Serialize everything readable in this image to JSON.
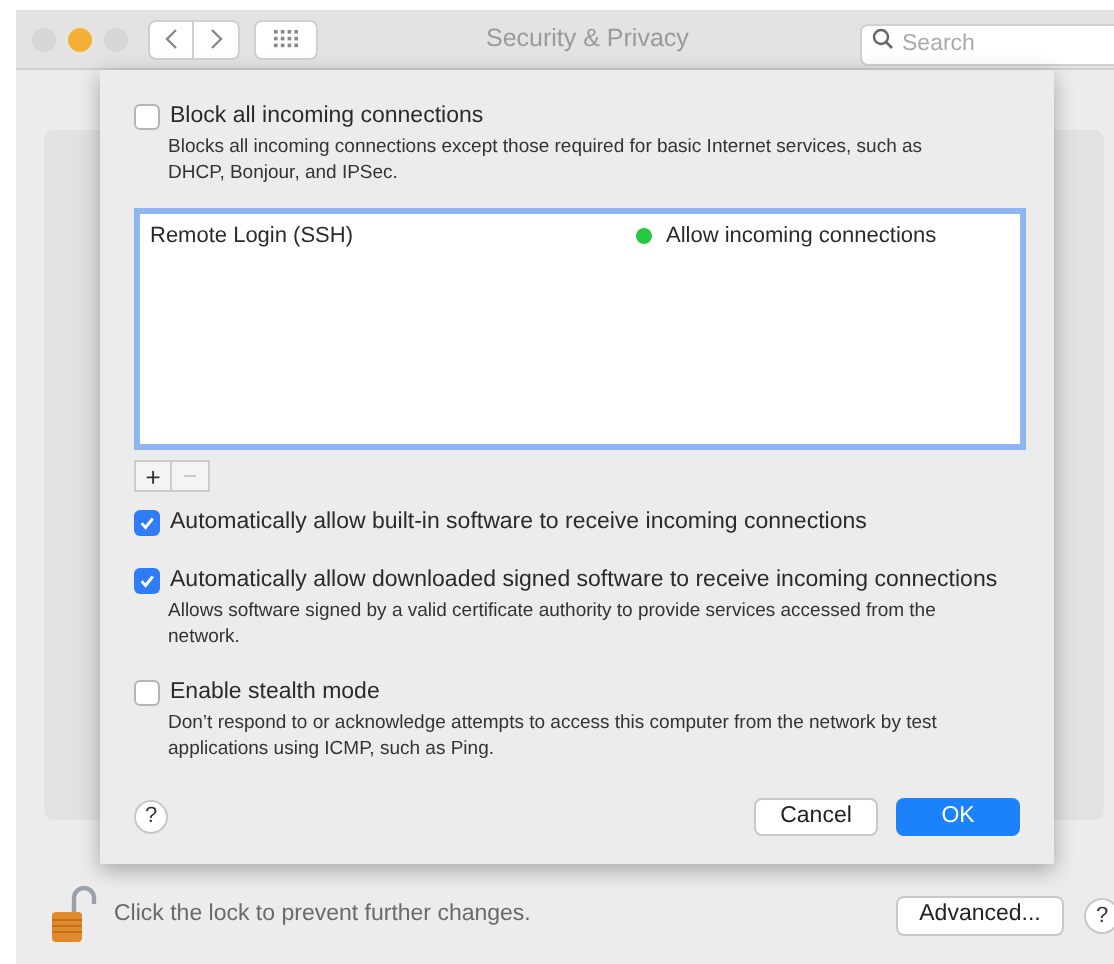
{
  "window": {
    "title": "Security & Privacy",
    "search": {
      "placeholder": "Search"
    }
  },
  "sheet": {
    "options_top": [
      {
        "label": "Block all incoming connections",
        "checked": false,
        "description": "Blocks all incoming connections except those required for basic Internet services, such as DHCP, Bonjour, and IPSec."
      }
    ],
    "apps": [
      {
        "name": "Remote Login (SSH)",
        "status": "Allow incoming connections",
        "color": "#28c840"
      }
    ],
    "add_label": "+",
    "remove_label": "−",
    "options": [
      {
        "label": "Automatically allow built-in software to receive incoming connections",
        "checked": true
      },
      {
        "label": "Automatically allow downloaded signed software to receive incoming connections",
        "checked": true,
        "description": "Allows software signed by a valid certificate authority to provide services accessed from the network."
      },
      {
        "label": "Enable stealth mode",
        "checked": false,
        "description": "Don’t respond to or acknowledge attempts to access this computer from the network by test applications using ICMP, such as Ping."
      }
    ],
    "help": "?",
    "buttons": [
      {
        "label": "Cancel",
        "kind": "secondary"
      },
      {
        "label": "OK",
        "kind": "primary"
      }
    ]
  },
  "footer": {
    "lock_text": "Click the lock to prevent further changes.",
    "advanced": "Advanced...",
    "help": "?"
  }
}
